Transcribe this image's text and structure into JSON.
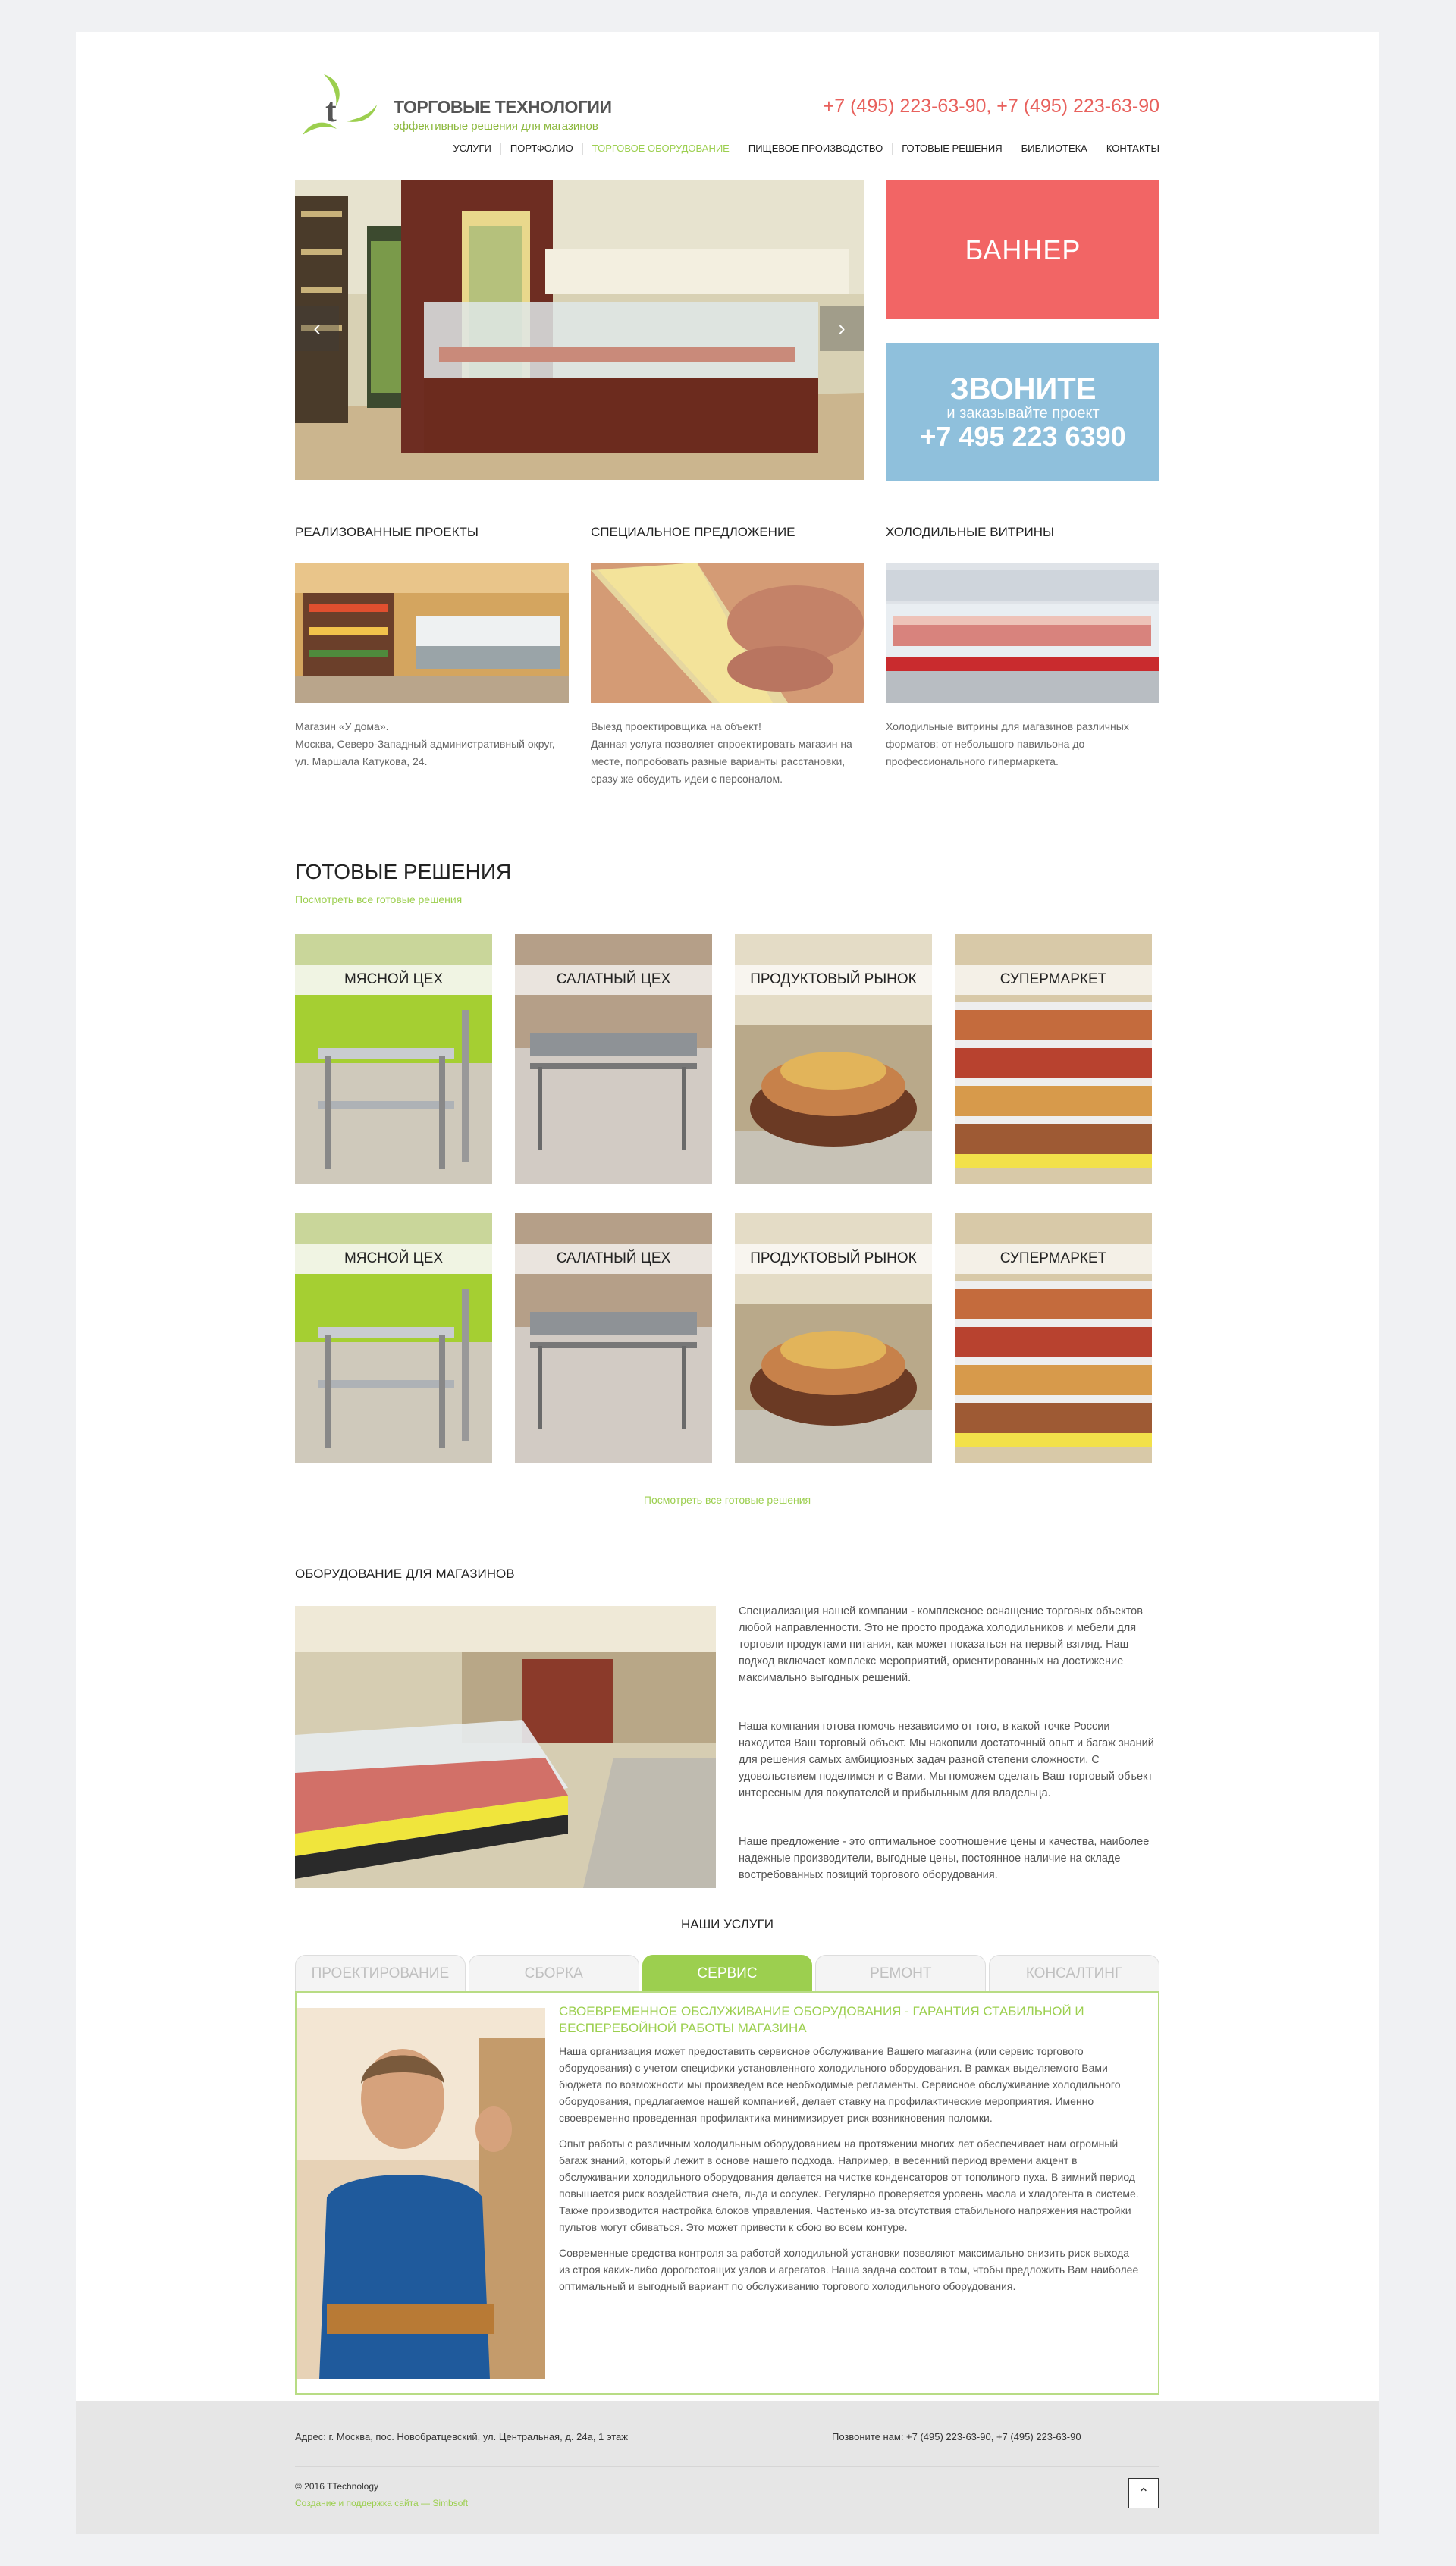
{
  "header": {
    "logo_title": "ТОРГОВЫЕ ТЕХНОЛОГИИ",
    "logo_subtitle": "эффективные решения для магазинов",
    "phones": "+7 (495) 223-63-90, +7 (495) 223-63-90",
    "nav": [
      "УСЛУГИ",
      "ПОРТФОЛИО",
      "ТОРГОВОЕ ОБОРУДОВАНИЕ",
      "ПИЩЕВОЕ ПРОИЗВОДСТВО",
      "ГОТОВЫЕ РЕШЕНИЯ",
      "БИБЛИОТЕКА",
      "КОНТАКТЫ"
    ],
    "nav_active_index": 2
  },
  "slider": {
    "prev_icon": "‹",
    "next_icon": "›"
  },
  "banners": {
    "red": "БАННЕР",
    "blue_line1": "ЗВОНИТЕ",
    "blue_line2": "и заказывайте проект",
    "blue_line3": "+7 495 223 6390"
  },
  "features": [
    {
      "title": "РЕАЛИЗОВАННЫЕ ПРОЕКТЫ",
      "text": "Магазин «У дома».\nМосква, Северо-Западный административный округ, ул. Маршала Катукова, 24."
    },
    {
      "title": "СПЕЦИАЛЬНОЕ ПРЕДЛОЖЕНИЕ",
      "text": "Выезд проектировщика на объект!\nДанная услуга позволяет спроектировать магазин на месте, попробовать разные варианты расстановки, сразу же обсудить идеи с персоналом."
    },
    {
      "title": "ХОЛОДИЛЬНЫЕ ВИТРИНЫ",
      "text": "Холодильные витрины  для магазинов различных форматов: от небольшого павильона до профессионального гипермаркета."
    }
  ],
  "solutions": {
    "title": "ГОТОВЫЕ РЕШЕНИЯ",
    "link_top": "Посмотреть все готовые решения",
    "link_bottom": "Посмотреть все готовые решения",
    "row1": [
      "МЯСНОЙ ЦЕХ",
      "САЛАТНЫЙ ЦЕХ",
      "ПРОДУКТОВЫЙ РЫНОК",
      "СУПЕРМАРКЕТ"
    ],
    "row2": [
      "МЯСНОЙ ЦЕХ",
      "САЛАТНЫЙ ЦЕХ",
      "ПРОДУКТОВЫЙ РЫНОК",
      "СУПЕРМАРКЕТ"
    ]
  },
  "equipment": {
    "title": "ОБОРУДОВАНИЕ ДЛЯ МАГАЗИНОВ",
    "p1": "Специализация нашей компании - комплексное оснащение торговых объектов любой направленности. Это не просто продажа холодильников и мебели для торговли продуктами питания, как может показаться на первый взгляд. Наш подход включает комплекс мероприятий, ориентированных на достижение максимально выгодных решений.",
    "p2": "Наша компания готова помочь независимо от того, в какой точке России находится Ваш торговый объект. Мы накопили достаточный опыт и багаж знаний для решения самых амбициозных задач разной степени сложности. С удовольствием поделимся и с Вами. Мы поможем сделать Ваш торговый объект интересным для покупателей и прибыльным для владельца.",
    "p3": "Наше предложение - это оптимальное соотношение цены и качества, наиболее надежные производители, выгодные цены, постоянное наличие на складе востребованных позиций торгового оборудования."
  },
  "services": {
    "title": "НАШИ УСЛУГИ",
    "tabs": [
      "ПРОЕКТИРОВАНИЕ",
      "СБОРКА",
      "СЕРВИС",
      "РЕМОНТ",
      "КОНСАЛТИНГ"
    ],
    "active_index": 2,
    "heading": "СВОЕВРЕМЕННОЕ ОБСЛУЖИВАНИЕ ОБОРУДОВАНИЯ - ГАРАНТИЯ СТАБИЛЬНОЙ И БЕСПЕРЕБОЙНОЙ РАБОТЫ МАГАЗИНА",
    "p1": "Наша организация может предоставить сервисное обслуживание Вашего магазина (или сервис торгового оборудования) с учетом специфики установленного холодильного оборудования. В рамках выделяемого Вами бюджета по возможности мы произведем все необходимые регламенты. Сервисное обслуживание холодильного оборудования, предлагаемое нашей компанией, делает ставку на профилактические мероприятия. Именно своевременно проведенная профилактика минимизирует риск возникновения поломки.",
    "p2": "Опыт работы с различным холодильным оборудованием на протяжении многих лет обеспечивает нам огромный багаж знаний, который лежит в основе нашего подхода. Например, в весенний период времени акцент в обслуживании холодильного оборудования делается на чистке конденсаторов от тополиного пуха. В зимний период повышается риск воздействия снега, льда и сосулек. Регулярно проверяется уровень масла и хладогента в системе. Также производится настройка блоков управления. Частенько из-за отсутствия стабильного напряжения настройки пультов могут сбиваться. Это может привести к сбою во всем контуре.",
    "p3": "Современные средства контроля за работой холодильной установки позволяют максимально снизить риск выхода из строя каких-либо дорогостоящих узлов и агрегатов. Наша задача состоит в том, чтобы предложить Вам наиболее оптимальный и выгодный вариант по обслуживанию торгового холодильного оборудования."
  },
  "footer": {
    "address": "Адрес: г. Москва, пос. Новобратцевский,  ул. Центральная, д. 24а, 1 этаж",
    "phone": "Позвоните нам: +7 (495) 223-63-90, +7 (495) 223-63-90",
    "copyright": "© 2016 TTechnology",
    "made_by": "Создание и поддержка сайта — Simbsoft",
    "up_icon": "⌃"
  },
  "colors": {
    "accent_green": "#9ccf4f",
    "accent_red": "#f26565",
    "accent_blue": "#8fc0dc",
    "phone_red": "#e8605c"
  }
}
